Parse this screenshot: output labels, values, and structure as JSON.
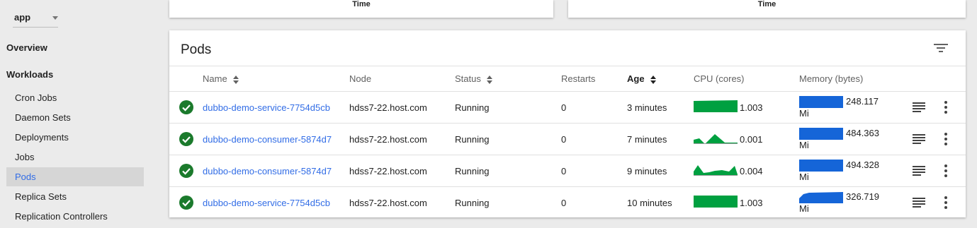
{
  "sidebar": {
    "namespace": "app",
    "overview": "Overview",
    "workloads": "Workloads",
    "items": [
      {
        "label": "Cron Jobs"
      },
      {
        "label": "Daemon Sets"
      },
      {
        "label": "Deployments"
      },
      {
        "label": "Jobs"
      },
      {
        "label": "Pods",
        "active": true
      },
      {
        "label": "Replica Sets"
      },
      {
        "label": "Replication Controllers"
      }
    ]
  },
  "top_cards": {
    "left_axis_label": "Time",
    "right_axis_label": "Time"
  },
  "pods": {
    "title": "Pods",
    "columns": {
      "name": "Name",
      "node": "Node",
      "status": "Status",
      "restarts": "Restarts",
      "age": "Age",
      "cpu": "CPU (cores)",
      "memory": "Memory (bytes)"
    },
    "rows": [
      {
        "name": "dubbo-demo-service-7754d5cb",
        "node": "hdss7-22.host.com",
        "status": "Running",
        "restarts": "0",
        "age": "3 minutes",
        "cpu": "1.003",
        "memory": "248.117",
        "memory_unit": "Mi"
      },
      {
        "name": "dubbo-demo-consumer-5874d7",
        "node": "hdss7-22.host.com",
        "status": "Running",
        "restarts": "0",
        "age": "7 minutes",
        "cpu": "0.001",
        "memory": "484.363",
        "memory_unit": "Mi"
      },
      {
        "name": "dubbo-demo-consumer-5874d7",
        "node": "hdss7-22.host.com",
        "status": "Running",
        "restarts": "0",
        "age": "9 minutes",
        "cpu": "0.004",
        "memory": "494.328",
        "memory_unit": "Mi"
      },
      {
        "name": "dubbo-demo-service-7754d5cb",
        "node": "hdss7-22.host.com",
        "status": "Running",
        "restarts": "0",
        "age": "10 minutes",
        "cpu": "1.003",
        "memory": "326.719",
        "memory_unit": "Mi"
      }
    ]
  },
  "colors": {
    "accent": "#326de6",
    "cpu_fill": "#00a040",
    "memory_fill": "#1565d8",
    "status_ok": "#1b7a2c"
  },
  "icons": {
    "status": "check-circle-icon",
    "sort": "sort-arrows-icon",
    "filter": "filter-icon",
    "logs": "logs-icon",
    "more": "more-vertical-icon"
  }
}
